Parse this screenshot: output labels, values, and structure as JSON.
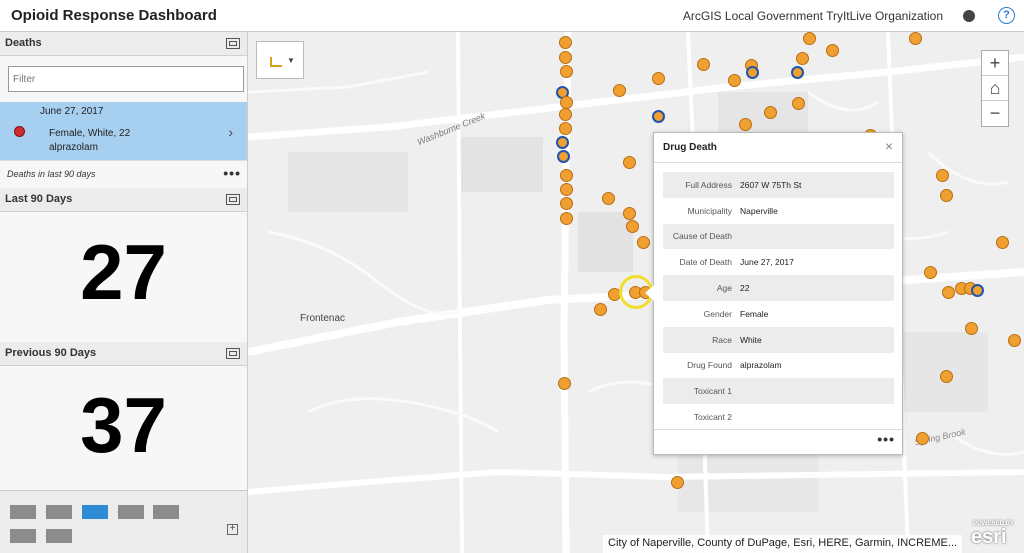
{
  "header": {
    "title": "Opioid Response Dashboard",
    "organization": "ArcGIS Local Government TryItLive Organization",
    "help_icon": "?"
  },
  "deaths_panel": {
    "title": "Deaths",
    "filter_placeholder": "Filter",
    "selected": {
      "date": "June 27, 2017",
      "description": "Female, White, 22",
      "drug": "alprazolam",
      "marker_color": "#d12d2d"
    },
    "footer_text": "Deaths in last 90 days",
    "more_label": "•••"
  },
  "last90": {
    "title": "Last 90 Days",
    "value": "27"
  },
  "previous90": {
    "title": "Previous 90 Days",
    "value": "37"
  },
  "tabs": {
    "count": 7,
    "active_index": 2,
    "plus_label": "+"
  },
  "map": {
    "zoom_in": "+",
    "home_icon": "home-icon",
    "zoom_out": "−",
    "labels": {
      "frontenac": "Frontenac",
      "creek": "Washburne Creek",
      "brook": "Spring Brook"
    },
    "attribution": "City of Naperville, County of DuPage, Esri, HERE, Garmin, INCREME...",
    "esri_powered": "POWERED BY",
    "esri_word": "esri",
    "point_color": "#f0a030",
    "highlight_color": "#1f55b0"
  },
  "popup": {
    "title": "Drug Death",
    "close_label": "×",
    "fields": [
      {
        "label": "Full Address",
        "value": "2607 W 75Th St"
      },
      {
        "label": "Municipality",
        "value": "Naperville"
      },
      {
        "label": "Cause of Death",
        "value": ""
      },
      {
        "label": "Date of Death",
        "value": "June 27, 2017"
      },
      {
        "label": "Age",
        "value": "22"
      },
      {
        "label": "Gender",
        "value": "Female"
      },
      {
        "label": "Race",
        "value": "White"
      },
      {
        "label": "Drug Found",
        "value": "alprazolam"
      },
      {
        "label": "Toxicant 1",
        "value": ""
      },
      {
        "label": "Toxicant 2",
        "value": ""
      }
    ],
    "more_label": "•••"
  }
}
